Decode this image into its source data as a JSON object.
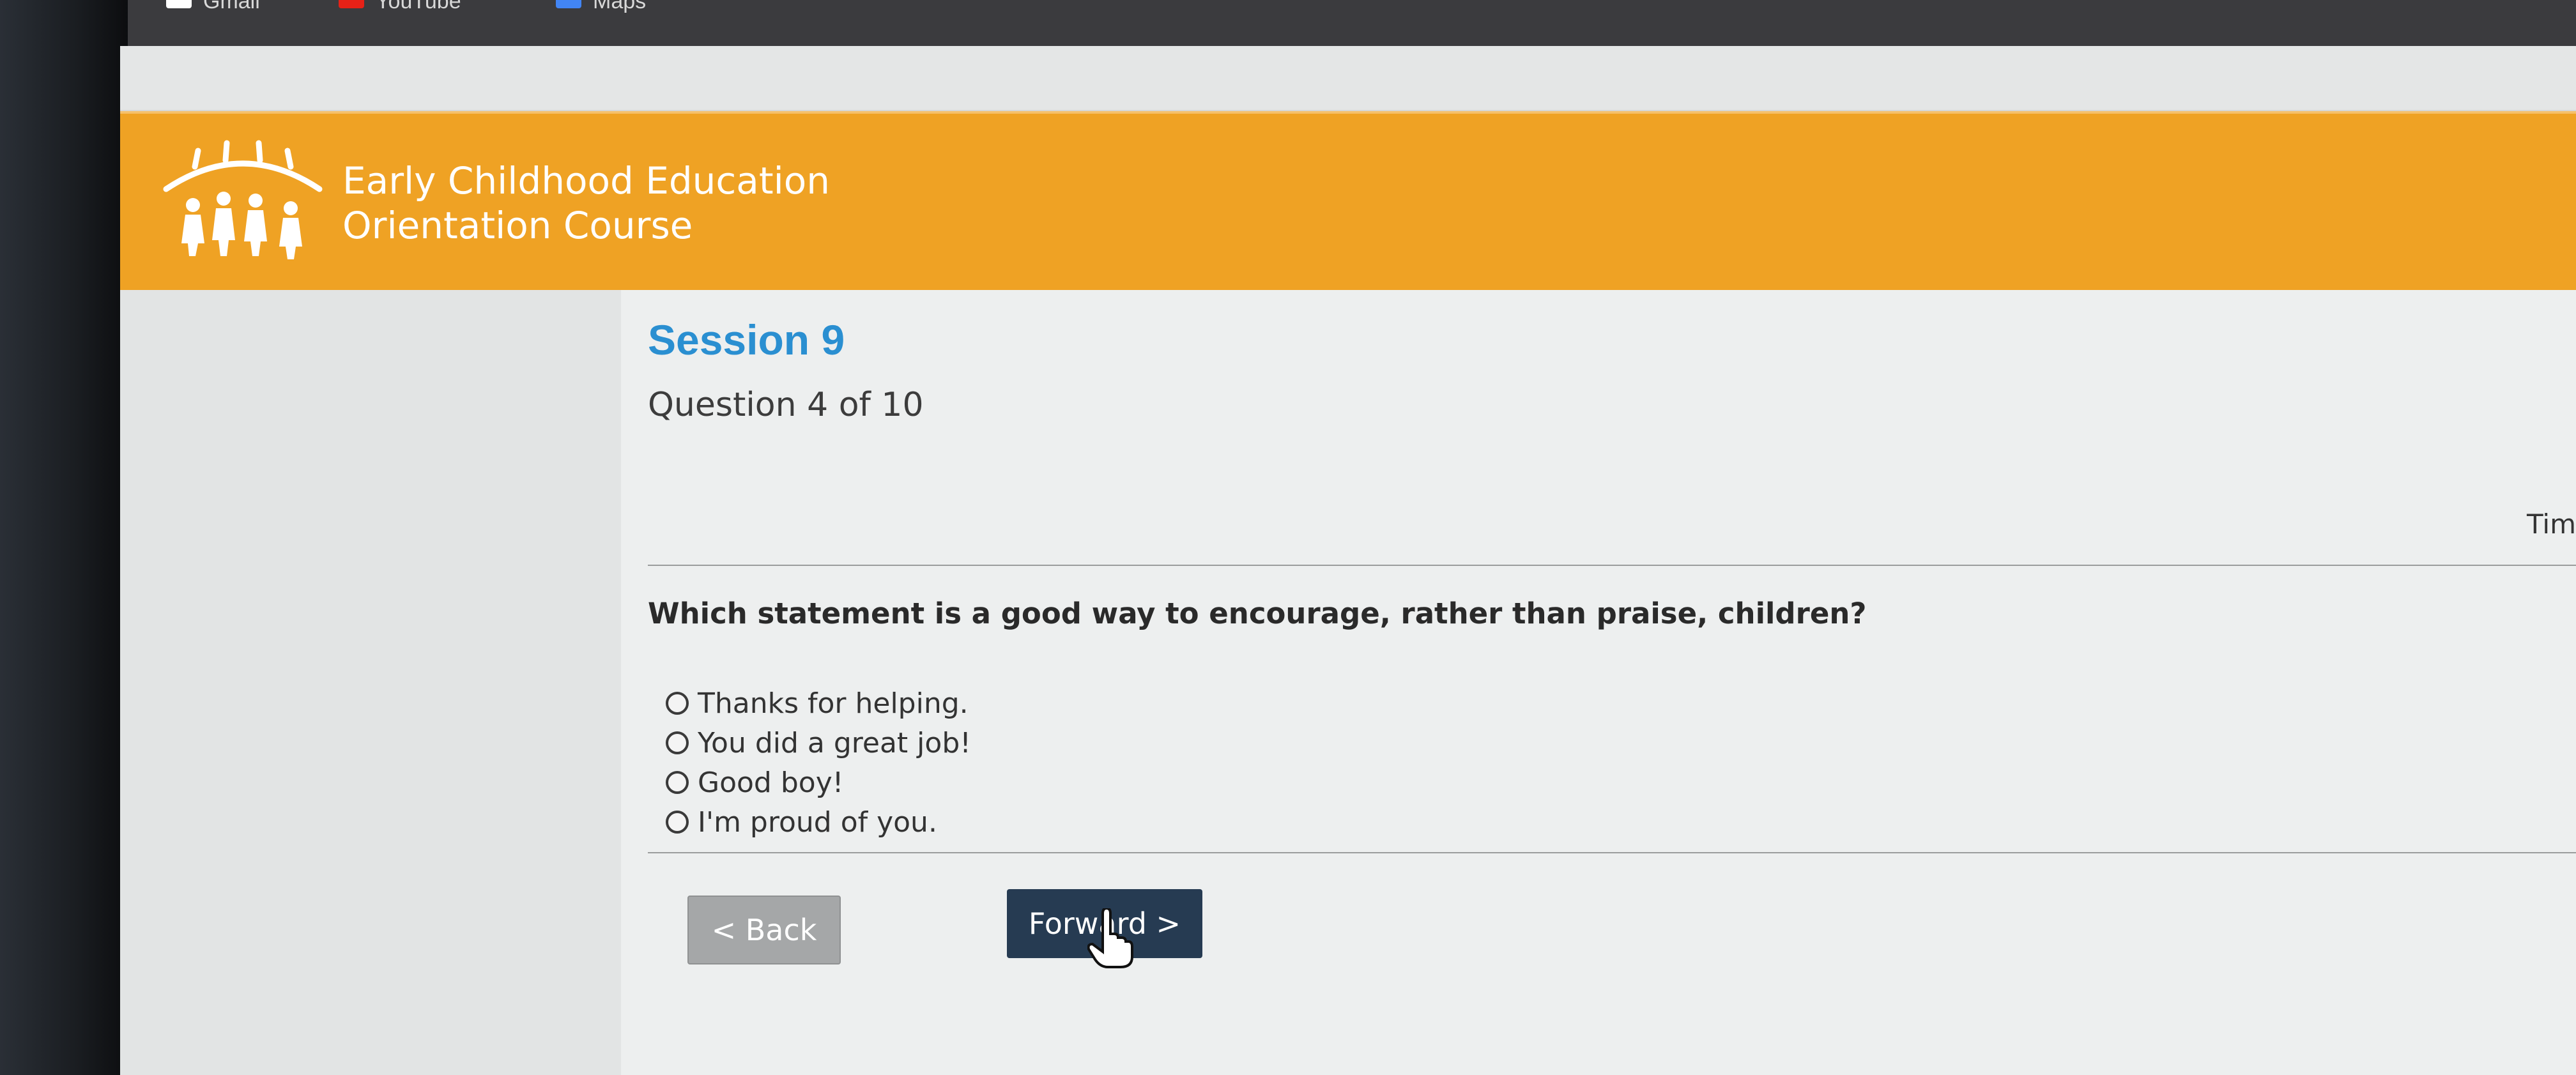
{
  "browser": {
    "bookmarks": [
      {
        "label": "Gmail",
        "icon": "gmail-icon",
        "color": "#ffffff"
      },
      {
        "label": "YouTube",
        "icon": "youtube-icon",
        "color": "#e62117"
      },
      {
        "label": "Maps",
        "icon": "maps-icon",
        "color": "#4285f4"
      }
    ]
  },
  "banner": {
    "line1": "Early Childhood Education",
    "line2": "Orientation Course",
    "logo": "children-logo",
    "color": "#efa224"
  },
  "quiz": {
    "session": "Session 9",
    "progress": "Question 4 of 10",
    "timer_label": "Tim",
    "question": "Which statement is a good way to encourage, rather than praise, children?",
    "options": [
      "Thanks for helping.",
      "You did a great job!",
      "Good boy!",
      "I'm proud of you."
    ],
    "selected": null
  },
  "nav": {
    "back_label": "< Back",
    "forward_label": "Forward >"
  },
  "colors": {
    "session": "#2a8fd1",
    "forward_button": "#263b52",
    "back_button": "#a5a7a8"
  }
}
